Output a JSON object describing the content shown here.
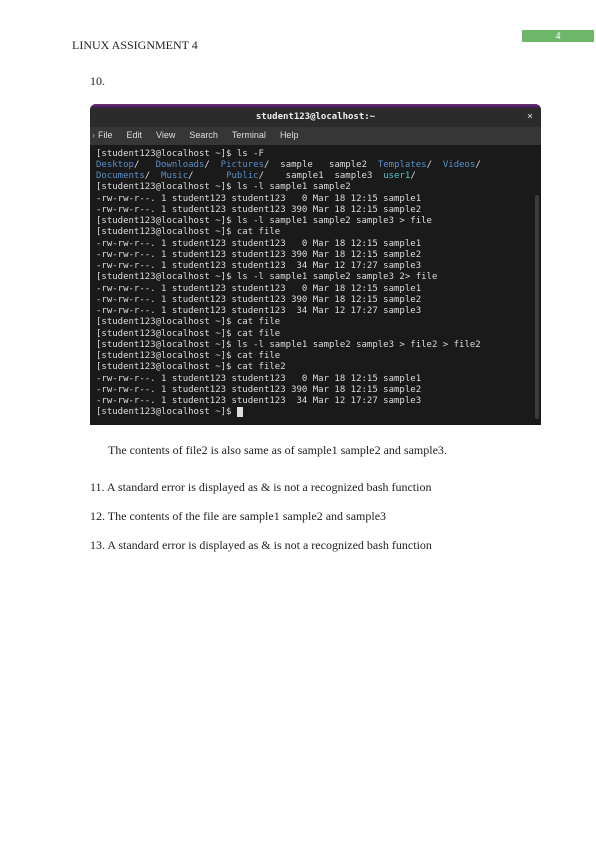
{
  "header": {
    "title": "LINUX ASSIGNMENT 4",
    "page_number": "4"
  },
  "item10": {
    "num": "10."
  },
  "terminal": {
    "title": "student123@localhost:~",
    "close_icon": "×",
    "menu": {
      "file": "File",
      "edit": "Edit",
      "view": "View",
      "search": "Search",
      "terminal": "Terminal",
      "help": "Help"
    },
    "lines": {
      "l1_prompt": "[student123@localhost ~]$ ls -F",
      "l2_desktop": "Desktop",
      "l2_slash1": "/   ",
      "l2_downloads": "Downloads",
      "l2_slash2": "/  ",
      "l2_pictures": "Pictures",
      "l2_slash3": "/  sample   sample2  ",
      "l2_templates": "Templates",
      "l2_slash4": "/  ",
      "l2_videos": "Videos",
      "l2_slash5": "/",
      "l3_documents": "Documents",
      "l3_slash1": "/  ",
      "l3_music": "Music",
      "l3_slash2": "/      ",
      "l3_public": "Public",
      "l3_slash3": "/    sample1  sample3  ",
      "l3_user1": "user1",
      "l3_slash4": "/",
      "l4": "[student123@localhost ~]$ ls -l sample1 sample2",
      "l5": "-rw-rw-r--. 1 student123 student123   0 Mar 18 12:15 sample1",
      "l6": "-rw-rw-r--. 1 student123 student123 390 Mar 18 12:15 sample2",
      "l7": "[student123@localhost ~]$ ls -l sample1 sample2 sample3 > file",
      "l8": "[student123@localhost ~]$ cat file",
      "l9": "-rw-rw-r--. 1 student123 student123   0 Mar 18 12:15 sample1",
      "l10": "-rw-rw-r--. 1 student123 student123 390 Mar 18 12:15 sample2",
      "l11": "-rw-rw-r--. 1 student123 student123  34 Mar 12 17:27 sample3",
      "l12": "[student123@localhost ~]$ ls -l sample1 sample2 sample3 2> file",
      "l13": "-rw-rw-r--. 1 student123 student123   0 Mar 18 12:15 sample1",
      "l14": "-rw-rw-r--. 1 student123 student123 390 Mar 18 12:15 sample2",
      "l15": "-rw-rw-r--. 1 student123 student123  34 Mar 12 17:27 sample3",
      "l16": "[student123@localhost ~]$ cat file",
      "l17": "[student123@localhost ~]$ cat file",
      "l18": "[student123@localhost ~]$ ls -l sample1 sample2 sample3 > file2 > file2",
      "l19": "[student123@localhost ~]$ cat file",
      "l20": "[student123@localhost ~]$ cat file2",
      "l21": "-rw-rw-r--. 1 student123 student123   0 Mar 18 12:15 sample1",
      "l22": "-rw-rw-r--. 1 student123 student123 390 Mar 18 12:15 sample2",
      "l23": "-rw-rw-r--. 1 student123 student123  34 Mar 12 17:27 sample3",
      "l24": "[student123@localhost ~]$ "
    }
  },
  "paragraph": {
    "text": "The contents of file2 is also same as of sample1 sample2 and sample3."
  },
  "items": {
    "i11": "11. A standard error is displayed as & is not a recognized bash function",
    "i12": "12. The contents of the file are sample1 sample2 and sample3",
    "i13": "13. A standard error is displayed as & is not a recognized bash function"
  }
}
